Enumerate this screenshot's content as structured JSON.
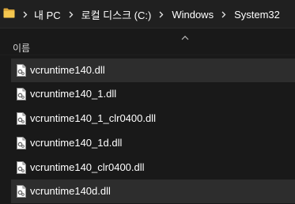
{
  "breadcrumb": {
    "items": [
      "내 PC",
      "로컬 디스크 (C:)",
      "Windows",
      "System32"
    ]
  },
  "list": {
    "column_header": "이름",
    "sort_direction": "ascending",
    "files": [
      {
        "name": "vcruntime140.dll",
        "selected": true
      },
      {
        "name": "vcruntime140_1.dll",
        "selected": false
      },
      {
        "name": "vcruntime140_1_clr0400.dll",
        "selected": false
      },
      {
        "name": "vcruntime140_1d.dll",
        "selected": false
      },
      {
        "name": "vcruntime140_clr0400.dll",
        "selected": false
      },
      {
        "name": "vcruntime140d.dll",
        "selected": true
      }
    ]
  },
  "colors": {
    "background": "#191919",
    "address_bar": "#202020",
    "selected_row": "#2d2d2d",
    "folder": "#f0c049"
  }
}
